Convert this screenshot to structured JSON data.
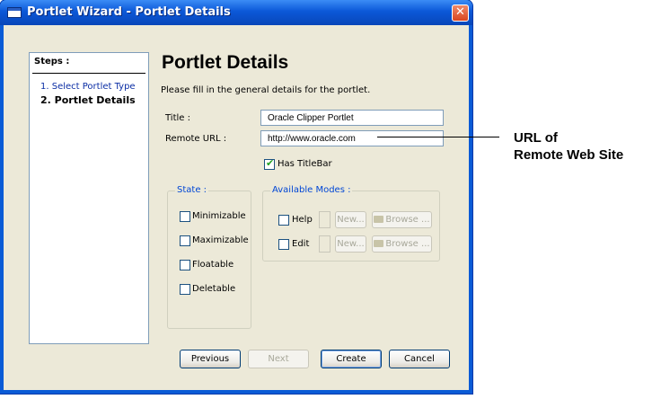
{
  "window": {
    "title": "Portlet Wizard - Portlet Details",
    "close_glyph": "✕"
  },
  "steps": {
    "title": "Steps :",
    "items": [
      "1. Select Portlet Type",
      "2. Portlet Details"
    ]
  },
  "page": {
    "heading": "Portlet Details",
    "description": "Please fill in the general details for the portlet."
  },
  "form": {
    "title_label": "Title :",
    "title_value": "Oracle Clipper Portlet",
    "url_label": "Remote URL :",
    "url_value": "http://www.oracle.com",
    "titlebar_label": "Has TitleBar",
    "titlebar_checked": true
  },
  "state": {
    "legend": "State :",
    "options": [
      "Minimizable",
      "Maximizable",
      "Floatable",
      "Deletable"
    ]
  },
  "modes": {
    "legend": "Available Modes :",
    "rows": [
      {
        "label": "Help",
        "new": "New...",
        "browse": "Browse ..."
      },
      {
        "label": "Edit",
        "new": "New...",
        "browse": "Browse ..."
      }
    ]
  },
  "buttons": {
    "previous": "Previous",
    "next": "Next",
    "create": "Create",
    "cancel": "Cancel"
  },
  "callout": {
    "line1": "URL of",
    "line2": "Remote Web Site"
  },
  "colors": {
    "title_bar": "#0b58d8",
    "dialog_bg": "#ece9d8",
    "legend_text": "#0046d5",
    "check": "#21a121"
  }
}
